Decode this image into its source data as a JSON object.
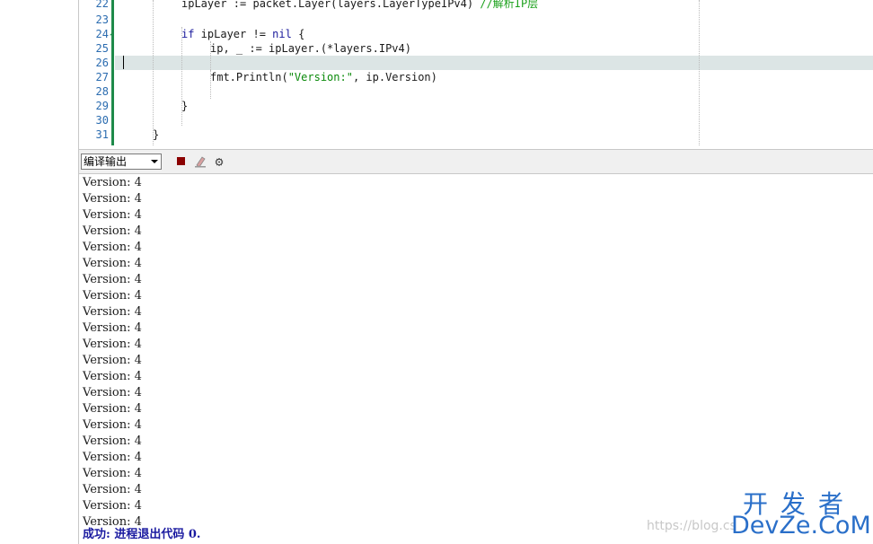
{
  "editor": {
    "lines": [
      {
        "no": "22",
        "code": [
          {
            "t": "ipLayer := packet.Layer(layers.LayerTypeIPv4) ",
            "c": ""
          },
          {
            "t": "//解析IP层",
            "c": "cmt"
          }
        ],
        "indent": 64
      },
      {
        "no": "23",
        "code": [],
        "indent": 0
      },
      {
        "no": "24",
        "code": [
          {
            "t": "if",
            "c": "kw"
          },
          {
            "t": " ipLayer != ",
            "c": ""
          },
          {
            "t": "nil",
            "c": "kw"
          },
          {
            "t": " {",
            "c": ""
          }
        ],
        "indent": 64
      },
      {
        "no": "25",
        "code": [
          {
            "t": "ip, _ := ipLayer.(*layers.IPv4)",
            "c": ""
          }
        ],
        "indent": 96
      },
      {
        "no": "26",
        "code": [],
        "indent": 0
      },
      {
        "no": "27",
        "code": [
          {
            "t": "fmt.Println(",
            "c": ""
          },
          {
            "t": "\"Version:\"",
            "c": "str"
          },
          {
            "t": ", ip.Version)",
            "c": ""
          }
        ],
        "indent": 96
      },
      {
        "no": "28",
        "code": [],
        "indent": 0
      },
      {
        "no": "29",
        "code": [
          {
            "t": "}",
            "c": ""
          }
        ],
        "indent": 64
      },
      {
        "no": "30",
        "code": [],
        "indent": 0
      },
      {
        "no": "31",
        "code": [
          {
            "t": "}",
            "c": ""
          }
        ],
        "indent": 32
      }
    ]
  },
  "output_panel": {
    "selector_value": "编译输出",
    "icons": {
      "stop": "stop-icon",
      "clear": "clear-icon",
      "settings": "gear-icon"
    },
    "lines": [
      "Version: 4",
      "Version: 4",
      "Version: 4",
      "Version: 4",
      "Version: 4",
      "Version: 4",
      "Version: 4",
      "Version: 4",
      "Version: 4",
      "Version: 4",
      "Version: 4",
      "Version: 4",
      "Version: 4",
      "Version: 4",
      "Version: 4",
      "Version: 4",
      "Version: 4",
      "Version: 4",
      "Version: 4",
      "Version: 4",
      "Version: 4",
      "Version: 4"
    ],
    "status": "成功: 进程退出代码 0."
  },
  "watermark": "https://blog.cs",
  "logo": {
    "top": "开发者",
    "bottom": "DevZe.CoM"
  },
  "colors": {
    "accent": "#2a6fc9",
    "gutter": "#1e8a4a",
    "current_line": "#dce5e5"
  }
}
